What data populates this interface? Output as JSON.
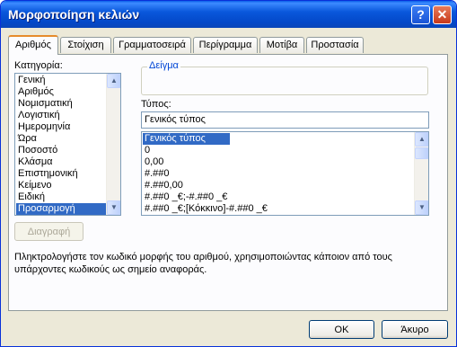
{
  "window": {
    "title": "Μορφοποίηση κελιών",
    "help_glyph": "?",
    "close_glyph": "✕"
  },
  "tabs": [
    {
      "label": "Αριθμός",
      "active": true
    },
    {
      "label": "Στοίχιση",
      "active": false
    },
    {
      "label": "Γραμματοσειρά",
      "active": false
    },
    {
      "label": "Περίγραμμα",
      "active": false
    },
    {
      "label": "Μοτίβα",
      "active": false
    },
    {
      "label": "Προστασία",
      "active": false
    }
  ],
  "category": {
    "label": "Κατηγορία:",
    "items": [
      "Γενική",
      "Αριθμός",
      "Νομισματική",
      "Λογιστική",
      "Ημερομηνία",
      "Ώρα",
      "Ποσοστό",
      "Κλάσμα",
      "Επιστημονική",
      "Κείμενο",
      "Ειδική",
      "Προσαρμογή"
    ],
    "selected": "Προσαρμογή"
  },
  "sample": {
    "label": "Δείγμα"
  },
  "type": {
    "label": "Τύπος:",
    "value": "Γενικός τύπος",
    "items": [
      "Γενικός τύπος",
      "0",
      "0,00",
      "#.##0",
      "#.##0,00",
      "#.##0 _€;-#.##0 _€",
      "#.##0 _€;[Κόκκινο]-#.##0 _€"
    ],
    "selected": "Γενικός τύπος"
  },
  "delete_button": {
    "label": "Διαγραφή",
    "enabled": false
  },
  "description": "Πληκτρολογήστε τον κωδικό μορφής του αριθμού, χρησιμοποιώντας κάποιον από τους υπάρχοντες κωδικούς ως σημείο αναφοράς.",
  "footer": {
    "ok_label": "OK",
    "cancel_label": "Άκυρο"
  },
  "colors": {
    "title_bar": "#0a58dc",
    "selection": "#316ac5",
    "active_tab_accent": "#e68b2c",
    "dialog_bg": "#ece9d8",
    "panel_bg": "#fcfcfe"
  },
  "icons": {
    "scroll_up": "chevron-up-icon",
    "scroll_down": "chevron-down-icon"
  }
}
